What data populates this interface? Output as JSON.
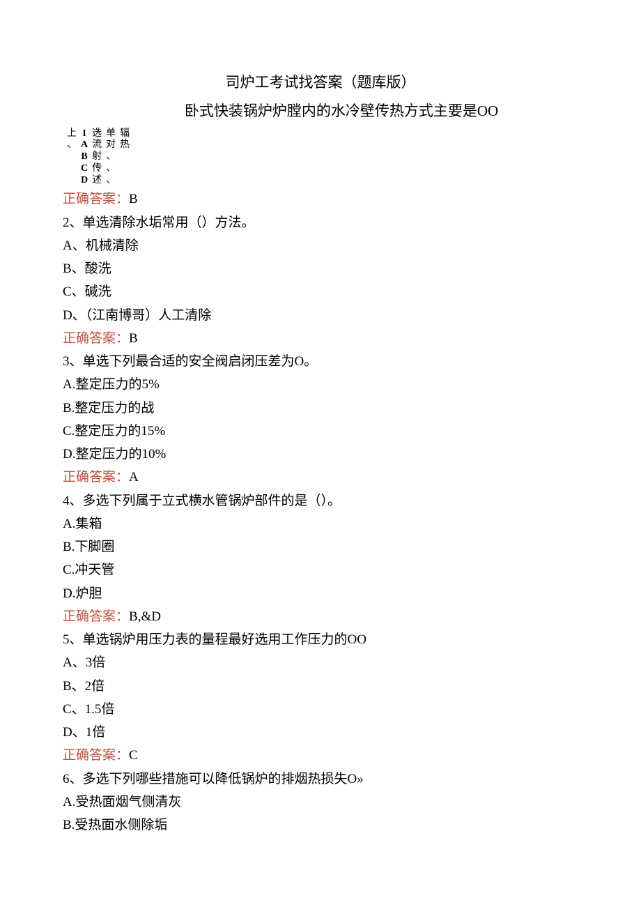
{
  "title": "司炉工考试找答案（题库版）",
  "subtitle": "卧式快装锅炉炉膛内的水冷壁传热方式主要是OO",
  "vertical": {
    "col1": [
      "上",
      "、"
    ],
    "col2": [
      "I",
      "A",
      "B",
      "C",
      "D"
    ],
    "col3": [
      "选",
      "流",
      "射",
      "传",
      "述"
    ],
    "col4": [
      "单",
      "对",
      "、",
      "、",
      "、"
    ],
    "col5": [
      "",
      "",
      "辐",
      "热",
      ""
    ]
  },
  "q1": {
    "answer_label": "正确答案：",
    "answer_value": "B"
  },
  "q2": {
    "stem": "2、单选清除水垢常用（）方法。",
    "optA": "A、机械清除",
    "optB": "B、酸洗",
    "optC": "C、碱洗",
    "optD": "D、（江南博哥）人工清除",
    "answer_label": "正确答案：",
    "answer_value": "B"
  },
  "q3": {
    "stem": "3、单选下列最合适的安全阀启闭压差为O。",
    "optA": "A.整定压力的5%",
    "optB": "B.整定压力的战",
    "optC": "C.整定压力的15%",
    "optD": "D.整定压力的10%",
    "answer_label": "正确答案：",
    "answer_value": "A"
  },
  "q4": {
    "stem": "4、多选下列属于立式横水管锅炉部件的是（）。",
    "optA": "A.集箱",
    "optB": "B.下脚圈",
    "optC": "C.冲天管",
    "optD": "D.炉胆",
    "answer_label": "正确答案：",
    "answer_value": "B,&D"
  },
  "q5": {
    "stem": "5、单选锅炉用压力表的量程最好选用工作压力的OO",
    "optA": "A、3倍",
    "optB": "B、2倍",
    "optC": "C、1.5倍",
    "optD": "D、1倍",
    "answer_label": "正确答案：",
    "answer_value": "C"
  },
  "q6": {
    "stem": "6、多选下列哪些措施可以降低锅炉的排烟热损失O»",
    "optA": "A.受热面烟气侧清灰",
    "optB": "B.受热面水侧除垢"
  }
}
